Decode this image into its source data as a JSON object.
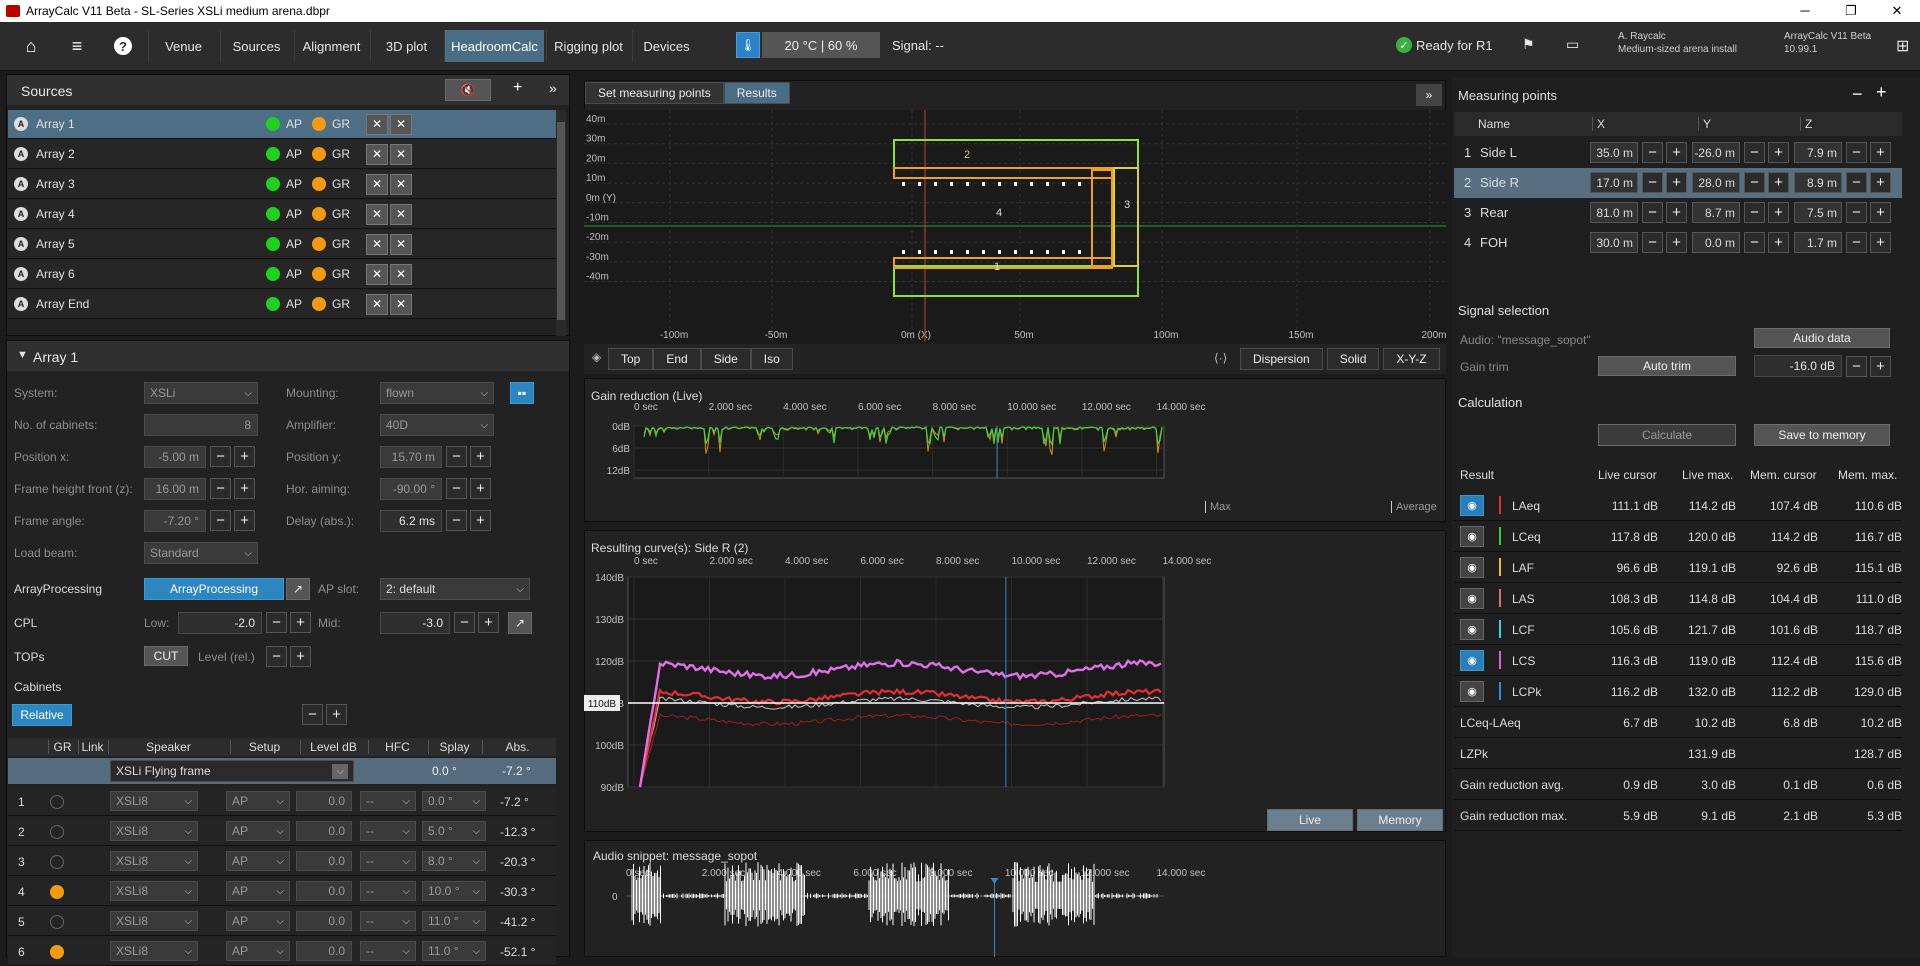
{
  "titlebar": {
    "title": "ArrayCalc V11 Beta - SL-Series XSLi medium arena.dbpr",
    "minimize": "─",
    "maximize": "❐",
    "close": "✕"
  },
  "nav": {
    "tabs": [
      "Venue",
      "Sources",
      "Alignment",
      "3D plot",
      "HeadroomCalc",
      "Rigging plot",
      "Devices"
    ],
    "active": "HeadroomCalc"
  },
  "env": {
    "temp": "20 °C | 60 %",
    "signal": "Signal: --",
    "ready": "Ready for R1"
  },
  "user": {
    "name": "A. Raycalc",
    "project": "Medium-sized arena install",
    "app": "ArrayCalc V11 Beta",
    "version": "10.99.1"
  },
  "sources": {
    "title": "Sources",
    "items": [
      {
        "letter": "A",
        "name": "Array 1",
        "ap": "AP",
        "gr": "GR"
      },
      {
        "letter": "A",
        "name": "Array 2",
        "ap": "AP",
        "gr": "GR"
      },
      {
        "letter": "A",
        "name": "Array 3",
        "ap": "AP",
        "gr": "GR"
      },
      {
        "letter": "A",
        "name": "Array 4",
        "ap": "AP",
        "gr": "GR"
      },
      {
        "letter": "A",
        "name": "Array 5",
        "ap": "AP",
        "gr": "GR"
      },
      {
        "letter": "A",
        "name": "Array 6",
        "ap": "AP",
        "gr": "GR"
      },
      {
        "letter": "A",
        "name": "Array End",
        "ap": "AP",
        "gr": "GR"
      }
    ]
  },
  "array": {
    "title": "Array 1",
    "system_label": "System:",
    "system": "XSLi",
    "mounting_label": "Mounting:",
    "mounting": "flown",
    "cabinets_label": "No. of cabinets:",
    "cabinets": "8",
    "amplifier_label": "Amplifier:",
    "amplifier": "40D",
    "posx_label": "Position x:",
    "posx": "-5.00 m",
    "posy_label": "Position y:",
    "posy": "15.70 m",
    "fh_label": "Frame height front (z):",
    "fh": "16.00 m",
    "haim_label": "Hor. aiming:",
    "haim": "-90.00 °",
    "fangle_label": "Frame angle:",
    "fangle": "-7.20 °",
    "delay_label": "Delay (abs.):",
    "delay": "6.2 ms",
    "loadbeam_label": "Load beam:",
    "loadbeam": "Standard",
    "ap_label": "ArrayProcessing",
    "ap_btn": "ArrayProcessing",
    "apslot_label": "AP slot:",
    "apslot": "2: default",
    "cpl_label": "CPL",
    "low_label": "Low:",
    "low": "-2.0",
    "mid_label": "Mid:",
    "mid": "-3.0",
    "tops_label": "TOPs",
    "tops_btn": "CUT",
    "level_label": "Level (rel.)",
    "cab_section": "Cabinets",
    "relative": "Relative",
    "headers": [
      "GR",
      "Link",
      "Speaker",
      "Setup",
      "Level dB",
      "HFC",
      "Splay",
      "Abs."
    ],
    "frame": {
      "speaker": "XSLi Flying frame",
      "splay": "0.0 °",
      "abs": "-7.2 °"
    },
    "rows": [
      {
        "n": "1",
        "gr": false,
        "spk": "XSLi8",
        "setup": "AP",
        "lvl": "0.0",
        "hfc": "--",
        "splay": "0.0 °",
        "abs": "-7.2 °"
      },
      {
        "n": "2",
        "gr": false,
        "spk": "XSLi8",
        "setup": "AP",
        "lvl": "0.0",
        "hfc": "--",
        "splay": "5.0 °",
        "abs": "-12.3 °"
      },
      {
        "n": "3",
        "gr": false,
        "spk": "XSLi8",
        "setup": "AP",
        "lvl": "0.0",
        "hfc": "--",
        "splay": "8.0 °",
        "abs": "-20.3 °"
      },
      {
        "n": "4",
        "gr": true,
        "spk": "XSLi8",
        "setup": "AP",
        "lvl": "0.0",
        "hfc": "--",
        "splay": "10.0 °",
        "abs": "-30.3 °"
      },
      {
        "n": "5",
        "gr": false,
        "spk": "XSLi8",
        "setup": "AP",
        "lvl": "0.0",
        "hfc": "--",
        "splay": "11.0 °",
        "abs": "-41.2 °"
      },
      {
        "n": "6",
        "gr": true,
        "spk": "XSLi8",
        "setup": "AP",
        "lvl": "0.0",
        "hfc": "--",
        "splay": "11.0 °",
        "abs": "-52.1 °"
      }
    ]
  },
  "center": {
    "tabs": [
      "Set measuring points",
      "Results"
    ],
    "active": "Results",
    "plan": {
      "yticks": [
        "40m",
        "30m",
        "20m",
        "10m",
        "0m (Y)",
        "-10m",
        "-20m",
        "-30m",
        "-40m"
      ],
      "xticks": [
        "-100m",
        "-50m",
        "0m (X)",
        "50m",
        "100m",
        "150m",
        "200m"
      ],
      "labels": [
        "2",
        "3",
        "4",
        "1"
      ]
    },
    "views": [
      "Top",
      "End",
      "Side",
      "Iso"
    ],
    "modes": [
      "Dispersion",
      "Solid",
      "X-Y-Z"
    ],
    "gain": {
      "title": "Gain reduction (Live)",
      "yticks": [
        "0dB",
        "6dB",
        "12dB"
      ],
      "max": "Max",
      "avg": "Average"
    },
    "timeticks": [
      "0 sec",
      "2.000 sec",
      "4.000 sec",
      "6.000 sec",
      "8.000 sec",
      "10.000 sec",
      "12.000 sec",
      "14.000 sec"
    ],
    "curve": {
      "title": "Resulting curve(s): Side R (2)",
      "yticks": [
        "140dB",
        "130dB",
        "120dB",
        "110dB",
        "100dB",
        "90dB"
      ],
      "marker": "110dB",
      "live": "Live",
      "memory": "Memory"
    },
    "snippet": {
      "title": "Audio snippet: message_sopot",
      "zero": "0"
    }
  },
  "measuring": {
    "title": "Measuring points",
    "headers": [
      "Name",
      "X",
      "Y",
      "Z"
    ],
    "rows": [
      {
        "n": "1",
        "name": "Side L",
        "x": "35.0 m",
        "y": "-26.0 m",
        "z": "7.9 m"
      },
      {
        "n": "2",
        "name": "Side R",
        "x": "17.0 m",
        "y": "28.0 m",
        "z": "8.9 m"
      },
      {
        "n": "3",
        "name": "Rear",
        "x": "81.0 m",
        "y": "8.7 m",
        "z": "7.5 m"
      },
      {
        "n": "4",
        "name": "FOH",
        "x": "30.0 m",
        "y": "0.0 m",
        "z": "1.7 m"
      }
    ]
  },
  "signal": {
    "title": "Signal selection",
    "audio": "Audio: \"message_sopot\"",
    "audio_btn": "Audio data",
    "trim_label": "Gain trim",
    "autotrim": "Auto trim",
    "trim": "-16.0 dB"
  },
  "calc": {
    "title": "Calculation",
    "calculate": "Calculate",
    "save": "Save to memory"
  },
  "results": {
    "headers": [
      "Result",
      "Live cursor",
      "Live max.",
      "Mem. cursor",
      "Mem. max."
    ],
    "rows": [
      {
        "name": "LAeq",
        "color": "#e03030",
        "on": true,
        "lc": "111.1 dB",
        "lm": "114.2 dB",
        "mc": "107.4 dB",
        "mm": "110.6 dB"
      },
      {
        "name": "LCeq",
        "color": "#30d030",
        "on": false,
        "lc": "117.8 dB",
        "lm": "120.0 dB",
        "mc": "114.2 dB",
        "mm": "116.7 dB"
      },
      {
        "name": "LAF",
        "color": "#e8c040",
        "on": false,
        "lc": "96.6 dB",
        "lm": "119.1 dB",
        "mc": "92.6 dB",
        "mm": "115.1 dB"
      },
      {
        "name": "LAS",
        "color": "#e07060",
        "on": false,
        "lc": "108.3 dB",
        "lm": "114.8 dB",
        "mc": "104.4 dB",
        "mm": "111.0 dB"
      },
      {
        "name": "LCF",
        "color": "#40d0e0",
        "on": false,
        "lc": "105.6 dB",
        "lm": "121.7 dB",
        "mc": "101.6 dB",
        "mm": "118.7 dB"
      },
      {
        "name": "LCS",
        "color": "#e060e0",
        "on": true,
        "lc": "116.3 dB",
        "lm": "119.0 dB",
        "mc": "112.4 dB",
        "mm": "115.6 dB"
      },
      {
        "name": "LCPk",
        "color": "#3090e0",
        "on": false,
        "lc": "116.2 dB",
        "lm": "132.0 dB",
        "mc": "112.2 dB",
        "mm": "129.0 dB"
      }
    ],
    "extra": [
      {
        "name": "LCeq-LAeq",
        "lc": "6.7 dB",
        "lm": "10.2 dB",
        "mc": "6.8 dB",
        "mm": "10.2 dB"
      },
      {
        "name": "LZPk",
        "lc": "",
        "lm": "131.9 dB",
        "mc": "",
        "mm": "128.7 dB"
      },
      {
        "name": "Gain reduction avg.",
        "lc": "0.9 dB",
        "lm": "3.0 dB",
        "mc": "0.1 dB",
        "mm": "0.6 dB"
      },
      {
        "name": "Gain reduction max.",
        "lc": "5.9 dB",
        "lm": "9.1 dB",
        "mc": "2.1 dB",
        "mm": "5.3 dB"
      }
    ]
  }
}
